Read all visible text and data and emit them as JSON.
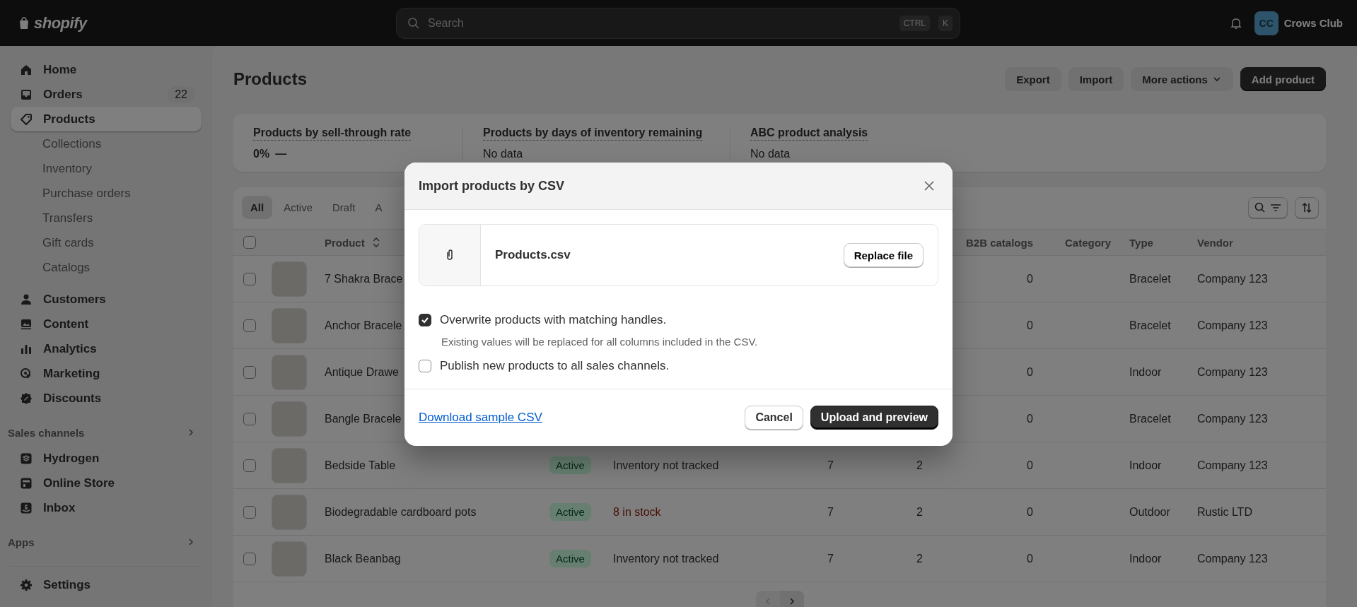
{
  "top_bar": {
    "logo": "shopify",
    "search": {
      "placeholder": "Search",
      "shortcut_keys": [
        "CTRL",
        "K"
      ]
    },
    "store": {
      "initials": "CC",
      "name": "Crows Club"
    }
  },
  "sidebar": {
    "items": [
      {
        "label": "Home",
        "selected": false
      },
      {
        "label": "Orders",
        "selected": false,
        "badge": "22"
      },
      {
        "label": "Products",
        "selected": true,
        "children": [
          {
            "label": "Collections",
            "selected": false
          },
          {
            "label": "Inventory",
            "selected": false
          },
          {
            "label": "Purchase orders",
            "selected": false
          },
          {
            "label": "Transfers",
            "selected": false
          },
          {
            "label": "Gift cards",
            "selected": false
          },
          {
            "label": "Catalogs",
            "selected": false
          }
        ]
      },
      {
        "label": "Customers",
        "selected": false
      },
      {
        "label": "Content",
        "selected": false
      },
      {
        "label": "Analytics",
        "selected": false
      },
      {
        "label": "Marketing",
        "selected": false
      },
      {
        "label": "Discounts",
        "selected": false
      }
    ],
    "sections": [
      {
        "title": "Sales channels",
        "items": [
          {
            "label": "Hydrogen",
            "selected": false
          },
          {
            "label": "Online Store",
            "selected": false
          },
          {
            "label": "Inbox",
            "selected": false
          }
        ]
      },
      {
        "title": "Apps"
      }
    ],
    "settings": {
      "label": "Settings",
      "selected": false
    }
  },
  "page": {
    "title": "Products",
    "actions": [
      {
        "label": "Export",
        "kind": "plain"
      },
      {
        "label": "Import",
        "kind": "plain"
      },
      {
        "label": "More actions",
        "kind": "menu"
      },
      {
        "label": "Add product",
        "kind": "primary"
      }
    ]
  },
  "metrics": [
    {
      "title": "Products by sell-through rate",
      "kind": "value",
      "value": "0%",
      "trend": "—"
    },
    {
      "title": "Products by days of inventory remaining",
      "kind": "empty",
      "value": "No data"
    },
    {
      "title": "ABC product analysis",
      "kind": "empty",
      "value": "No data"
    }
  ],
  "table": {
    "tabs": [
      {
        "label": "All",
        "selected": true
      },
      {
        "label": "Active",
        "selected": false
      },
      {
        "label": "Draft",
        "selected": false
      },
      {
        "label": "A",
        "selected": false
      }
    ],
    "select_all": false,
    "columns": {
      "product": "Product",
      "b2b_catalogs": "B2B catalogs",
      "category": "Category",
      "type": "Type",
      "vendor": "Vendor"
    },
    "rows": [
      {
        "product": "7 Shakra Brace",
        "selected": false,
        "b2b_catalogs": "0",
        "type": "Bracelet",
        "vendor": "Company 123"
      },
      {
        "product": "Anchor Bracele",
        "selected": false,
        "b2b_catalogs": "0",
        "type": "Bracelet",
        "vendor": "Company 123"
      },
      {
        "product": "Antique Drawe",
        "selected": false,
        "b2b_catalogs": "0",
        "type": "Indoor",
        "vendor": "Company 123"
      },
      {
        "product": "Bangle Bracele",
        "selected": false,
        "b2b_catalogs": "0",
        "type": "Bracelet",
        "vendor": "Company 123"
      },
      {
        "product": "Bedside Table",
        "selected": false,
        "status": "Active",
        "inventory": "Inventory not tracked",
        "low_stock": false,
        "column_4": "7",
        "column_5": "2",
        "b2b_catalogs": "0",
        "type": "Indoor",
        "vendor": "Company 123"
      },
      {
        "product": "Biodegradable cardboard pots",
        "selected": false,
        "status": "Active",
        "inventory": "8 in stock",
        "low_stock": true,
        "column_4": "7",
        "column_5": "2",
        "b2b_catalogs": "0",
        "type": "Outdoor",
        "vendor": "Rustic LTD"
      },
      {
        "product": "Black Beanbag",
        "selected": false,
        "status": "Active",
        "inventory": "Inventory not tracked",
        "low_stock": false,
        "column_4": "7",
        "column_5": "2",
        "b2b_catalogs": "0",
        "type": "Indoor",
        "vendor": "Company 123"
      }
    ],
    "pagination": {
      "previous_disabled": true,
      "next_disabled": false
    }
  },
  "modal": {
    "title": "Import products by CSV",
    "file": {
      "name": "Products.csv",
      "button": "Replace file"
    },
    "options": [
      {
        "label": "Overwrite products with matching handles.",
        "checked": true,
        "help": "Existing values will be replaced for all columns included in the CSV."
      },
      {
        "label": "Publish new products to all sales channels.",
        "checked": false
      }
    ],
    "link": "Download sample CSV",
    "buttons": [
      {
        "label": "Cancel",
        "kind": "secondary"
      },
      {
        "label": "Upload and preview",
        "kind": "primary"
      }
    ]
  }
}
